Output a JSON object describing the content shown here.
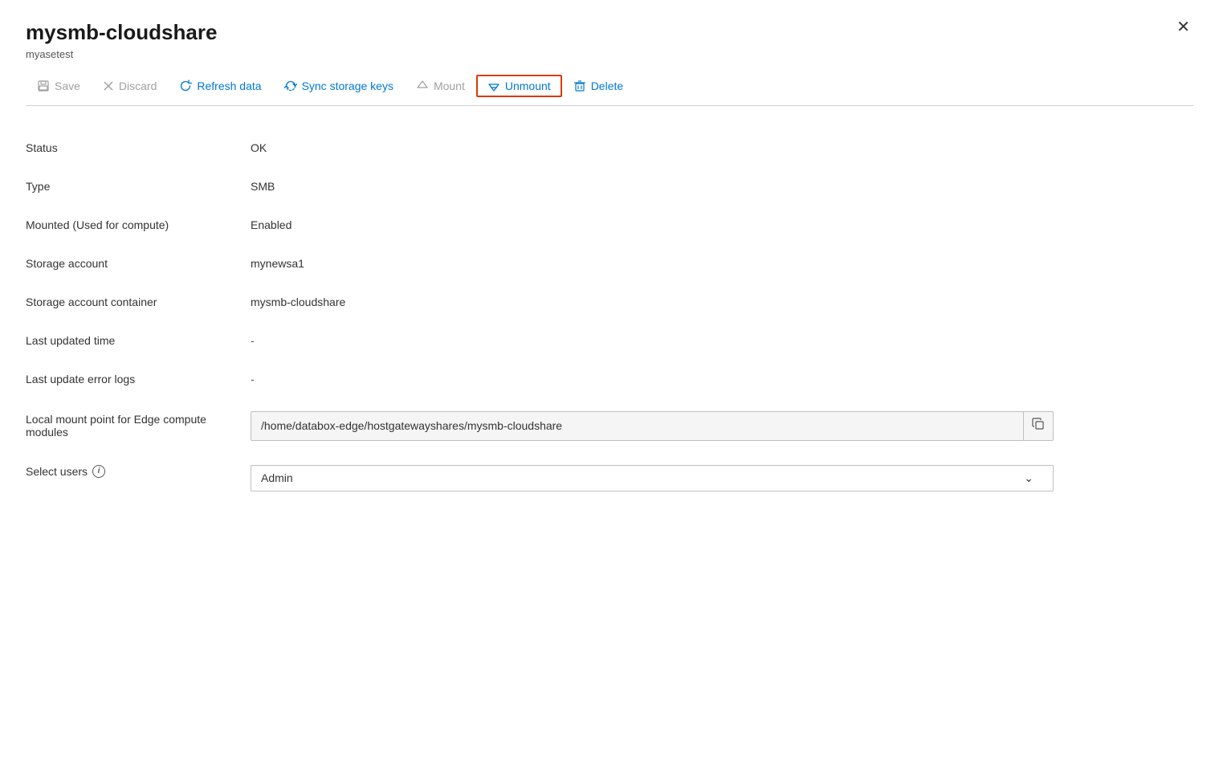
{
  "panel": {
    "title": "mysmb-cloudshare",
    "subtitle": "myasetest",
    "close_label": "✕"
  },
  "toolbar": {
    "save_label": "Save",
    "discard_label": "Discard",
    "refresh_label": "Refresh data",
    "sync_label": "Sync storage keys",
    "mount_label": "Mount",
    "unmount_label": "Unmount",
    "delete_label": "Delete"
  },
  "fields": [
    {
      "label": "Status",
      "value": "OK",
      "type": "text"
    },
    {
      "label": "Type",
      "value": "SMB",
      "type": "text"
    },
    {
      "label": "Mounted (Used for compute)",
      "value": "Enabled",
      "type": "text"
    },
    {
      "label": "Storage account",
      "value": "mynewsa1",
      "type": "text"
    },
    {
      "label": "Storage account container",
      "value": "mysmb-cloudshare",
      "type": "text"
    },
    {
      "label": "Last updated time",
      "value": "-",
      "type": "text"
    },
    {
      "label": "Last update error logs",
      "value": "-",
      "type": "text"
    },
    {
      "label": "Local mount point for Edge compute modules",
      "value": "/home/databox-edge/hostgatewayshares/mysmb-cloudshare",
      "type": "copy"
    },
    {
      "label": "Select users",
      "value": "Admin",
      "type": "select",
      "has_info": true
    }
  ],
  "colors": {
    "blue": "#0078d4",
    "red_border": "#d83b01",
    "disabled": "#a0a0a0"
  }
}
